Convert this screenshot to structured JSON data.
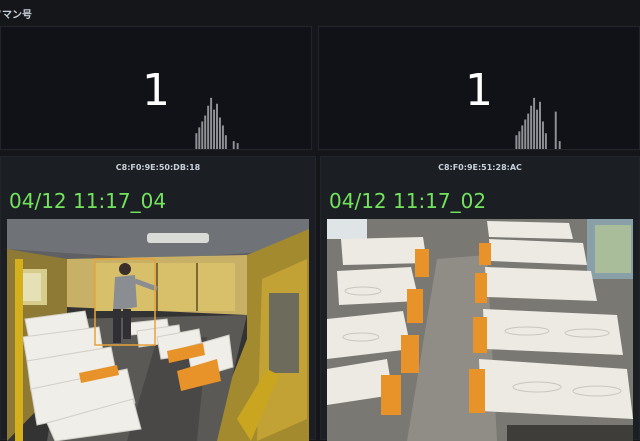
{
  "page": {
    "title": "ソマン号"
  },
  "stats": [
    {
      "value": "1"
    },
    {
      "value": "1"
    }
  ],
  "cameras": [
    {
      "mac": "C8:F0:9E:50:DB:18",
      "timestamp": "04/12 11:17_04"
    },
    {
      "mac": "C8:F0:9E:51:28:AC",
      "timestamp": "04/12 11:17_02"
    }
  ],
  "colors": {
    "background": "#141619",
    "timestamp_green": "#73e35d",
    "detection_box": "#e8a23a"
  }
}
